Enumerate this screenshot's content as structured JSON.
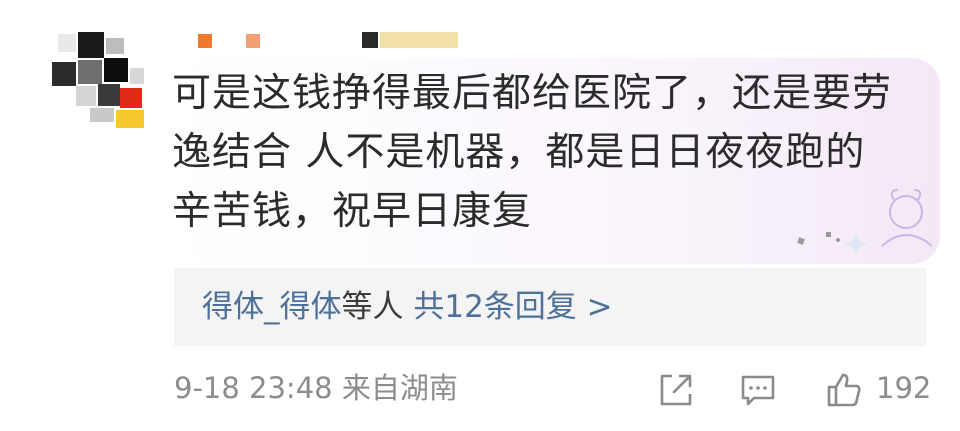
{
  "comment": {
    "text": "可是这钱挣得最后都给医院了，还是要劳逸结合 人不是机器，都是日日夜夜跑的辛苦钱，祝早日康复"
  },
  "replies": {
    "names": "得体_得体",
    "suffix": "等人",
    "summary": "共12条回复 >"
  },
  "meta": {
    "time": "9-18 23:48",
    "location": "来自湖南",
    "time_location": "9-18 23:48 来自湖南",
    "like_count": "192"
  },
  "icons": [
    "share-icon",
    "comment-icon",
    "like-icon",
    "avatar-mosaic",
    "username-mosaic",
    "sticker"
  ],
  "colors": {
    "reply_link": "#4f7199",
    "meta_gray": "#8c8c8c",
    "reply_bg": "#f4f4f5",
    "bubble_tint": "#f3e8f6"
  }
}
